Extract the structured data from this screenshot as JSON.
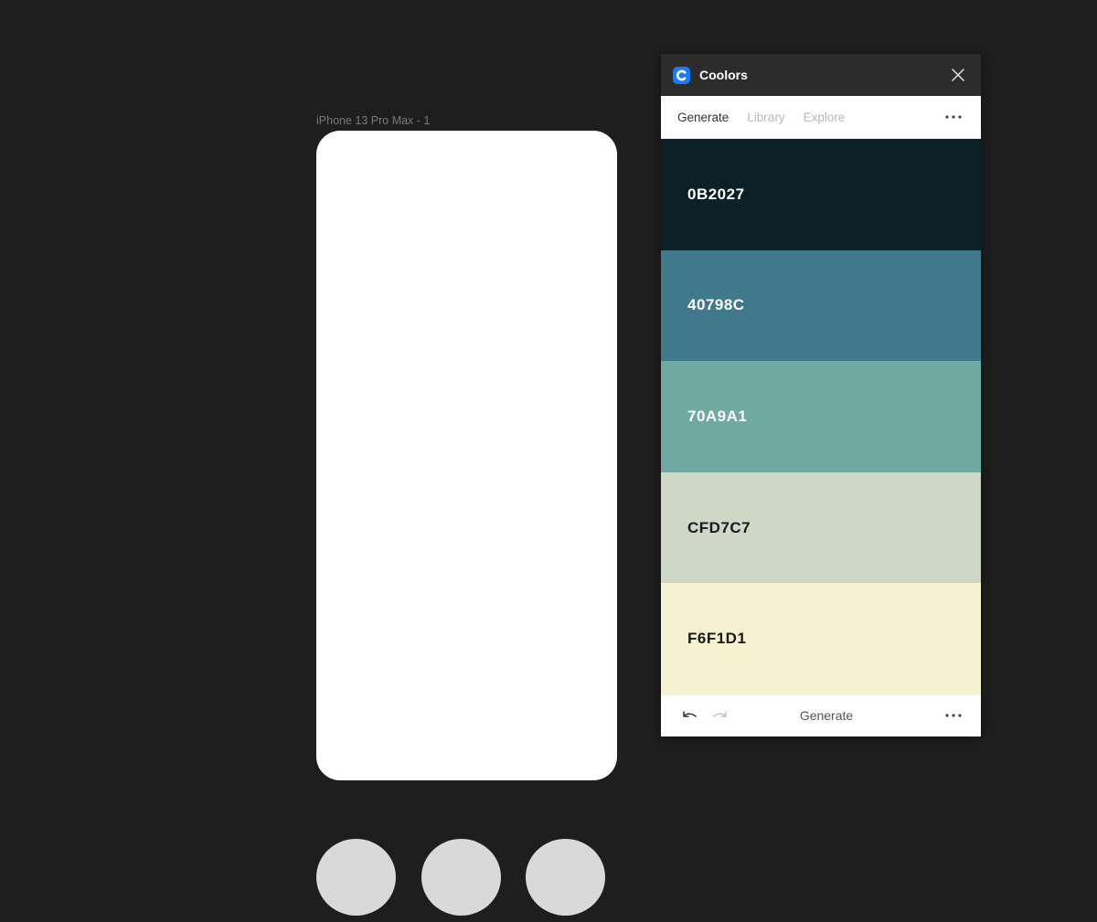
{
  "canvas": {
    "frame_label": "iPhone 13 Pro Max - 1"
  },
  "plugin": {
    "title": "Coolors",
    "icons": {
      "logo": "coolors-logo-icon",
      "close": "close-icon",
      "more": "more-horizontal-icon",
      "undo": "undo-icon",
      "redo": "redo-icon"
    },
    "tabs": [
      {
        "label": "Generate",
        "active": true
      },
      {
        "label": "Library",
        "active": false
      },
      {
        "label": "Explore",
        "active": false
      }
    ],
    "palette": [
      {
        "hex": "0B2027",
        "color": "#0B2027",
        "text_color": "#ffffff"
      },
      {
        "hex": "40798C",
        "color": "#40798C",
        "text_color": "#ffffff"
      },
      {
        "hex": "70A9A1",
        "color": "#70A9A1",
        "text_color": "#ffffff"
      },
      {
        "hex": "CFD7C7",
        "color": "#CFD7C7",
        "text_color": "#1a1a1a"
      },
      {
        "hex": "F6F1D1",
        "color": "#F6F1D1",
        "text_color": "#1a1a1a"
      }
    ],
    "footer": {
      "generate_label": "Generate"
    }
  }
}
